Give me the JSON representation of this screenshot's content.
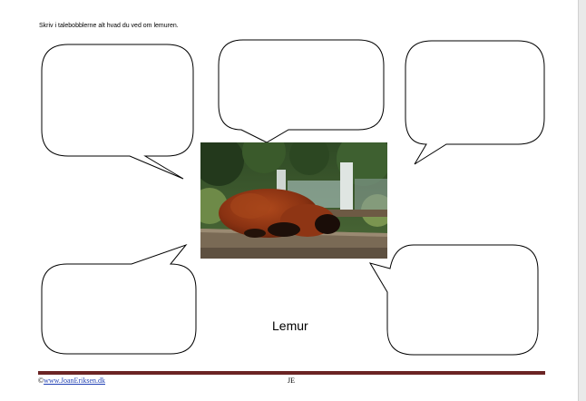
{
  "instruction": "Skriv i talebobblerne alt hvad du ved om lemuren.",
  "caption": "Lemur",
  "footer": {
    "copyright_symbol": "©",
    "link_text": "www.JoanEriksen.dk",
    "initials": "JE"
  },
  "colors": {
    "footer_rule": "#6b2424",
    "link": "#1f3fb3",
    "bubble_stroke": "#000000"
  },
  "image": {
    "subject": "red ruffed lemur lying on a wooden plank"
  }
}
